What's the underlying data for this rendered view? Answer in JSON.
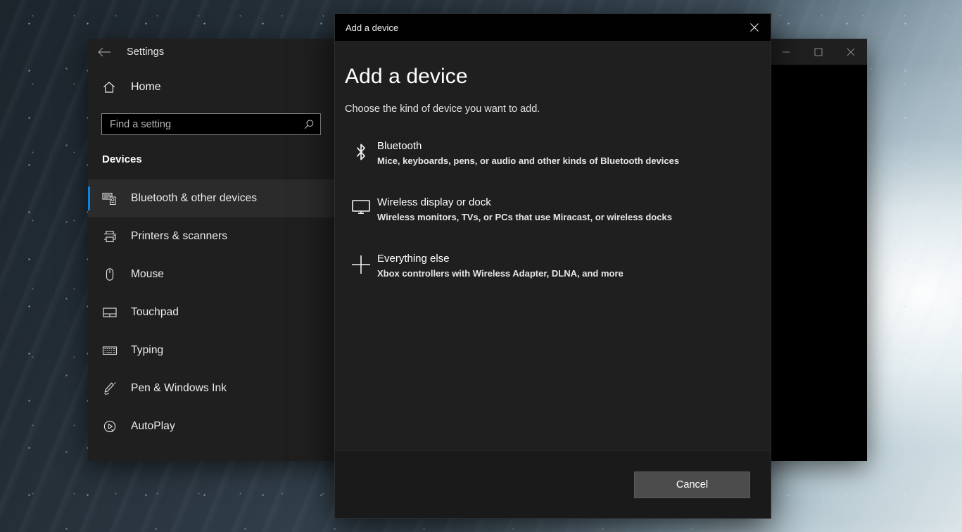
{
  "settings_window": {
    "titlebar": {
      "back_label": "Back",
      "title": "Settings",
      "minimize_label": "Minimize",
      "maximize_label": "Maximize",
      "close_label": "Close"
    },
    "home": {
      "label": "Home",
      "icon": "home-icon"
    },
    "search": {
      "placeholder": "Find a setting",
      "value": "",
      "icon": "search-icon"
    },
    "section_title": "Devices",
    "nav_items": [
      {
        "label": "Bluetooth & other devices",
        "icon": "bluetooth-devices-icon",
        "selected": true
      },
      {
        "label": "Printers & scanners",
        "icon": "printer-icon",
        "selected": false
      },
      {
        "label": "Mouse",
        "icon": "mouse-icon",
        "selected": false
      },
      {
        "label": "Touchpad",
        "icon": "touchpad-icon",
        "selected": false
      },
      {
        "label": "Typing",
        "icon": "keyboard-icon",
        "selected": false
      },
      {
        "label": "Pen & Windows Ink",
        "icon": "pen-icon",
        "selected": false
      },
      {
        "label": "AutoPlay",
        "icon": "autoplay-icon",
        "selected": false
      }
    ]
  },
  "dialog": {
    "titlebar_title": "Add a device",
    "close_label": "Close",
    "heading": "Add a device",
    "subheading": "Choose the kind of device you want to add.",
    "device_options": [
      {
        "title": "Bluetooth",
        "description": "Mice, keyboards, pens, or audio and other kinds of Bluetooth devices",
        "icon": "bluetooth-icon"
      },
      {
        "title": "Wireless display or dock",
        "description": "Wireless monitors, TVs, or PCs that use Miracast, or wireless docks",
        "icon": "monitor-icon"
      },
      {
        "title": "Everything else",
        "description": "Xbox controllers with Wireless Adapter, DLNA, and more",
        "icon": "plus-icon"
      }
    ],
    "cancel_label": "Cancel"
  },
  "colors": {
    "accent_selection": "#0a84e0",
    "dialog_background": "#1f1f1f",
    "sidebar_background": "#1f1f1f",
    "content_background": "#000000",
    "cancel_button": "#4c4c4c"
  }
}
